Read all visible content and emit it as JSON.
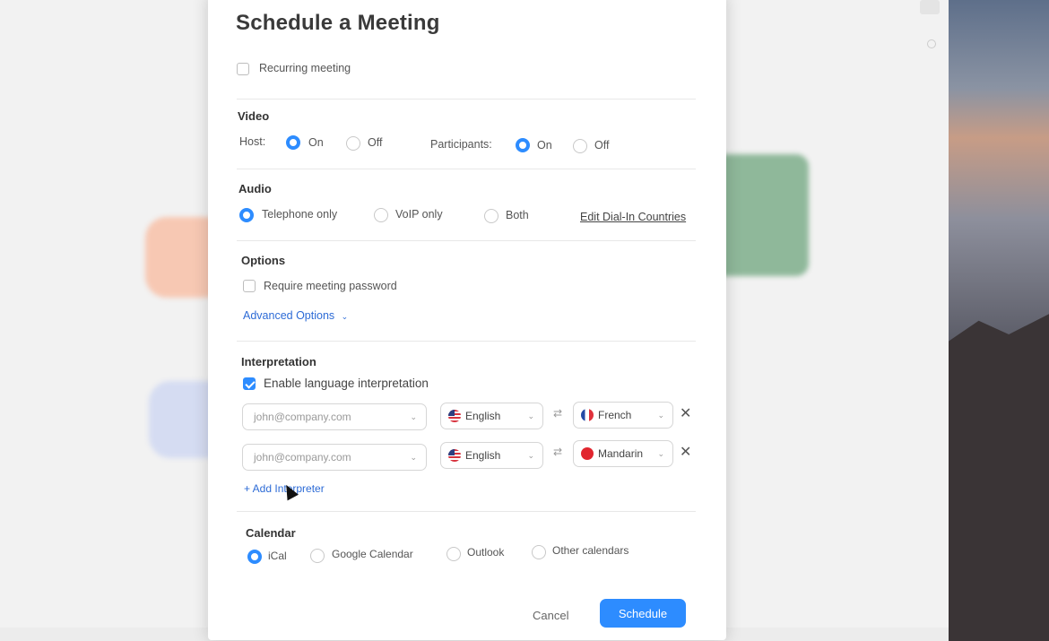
{
  "dialog": {
    "title": "Schedule a Meeting",
    "recurring_label": "Recurring meeting",
    "recurring_checked": false
  },
  "video": {
    "heading": "Video",
    "host_label": "Host:",
    "participants_label": "Participants:",
    "on_label": "On",
    "off_label": "Off",
    "host_value": "On",
    "participants_value": "On"
  },
  "audio": {
    "heading": "Audio",
    "options": [
      "Telephone only",
      "VoIP only",
      "Both"
    ],
    "selected": "Telephone only",
    "edit_link": "Edit Dial-In Countries"
  },
  "options": {
    "heading": "Options",
    "password_label": "Require meeting password",
    "password_checked": false,
    "advanced_link": "Advanced Options",
    "advanced_caret": "⌄"
  },
  "interpretation": {
    "heading": "Interpretation",
    "enable_label": "Enable language interpretation",
    "enable_checked": true,
    "rows": [
      {
        "email_placeholder": "john@company.com",
        "from_lang": "English",
        "to_lang": "French"
      },
      {
        "email_placeholder": "john@company.com",
        "from_lang": "English",
        "to_lang": "Mandarin"
      }
    ],
    "add_link": "+ Add Interpreter"
  },
  "calendar": {
    "heading": "Calendar",
    "options": [
      "iCal",
      "Google Calendar",
      "Outlook",
      "Other calendars"
    ],
    "selected": "iCal"
  },
  "footer": {
    "cancel_label": "Cancel",
    "schedule_label": "Schedule"
  },
  "colors": {
    "accent": "#2d8cff"
  }
}
